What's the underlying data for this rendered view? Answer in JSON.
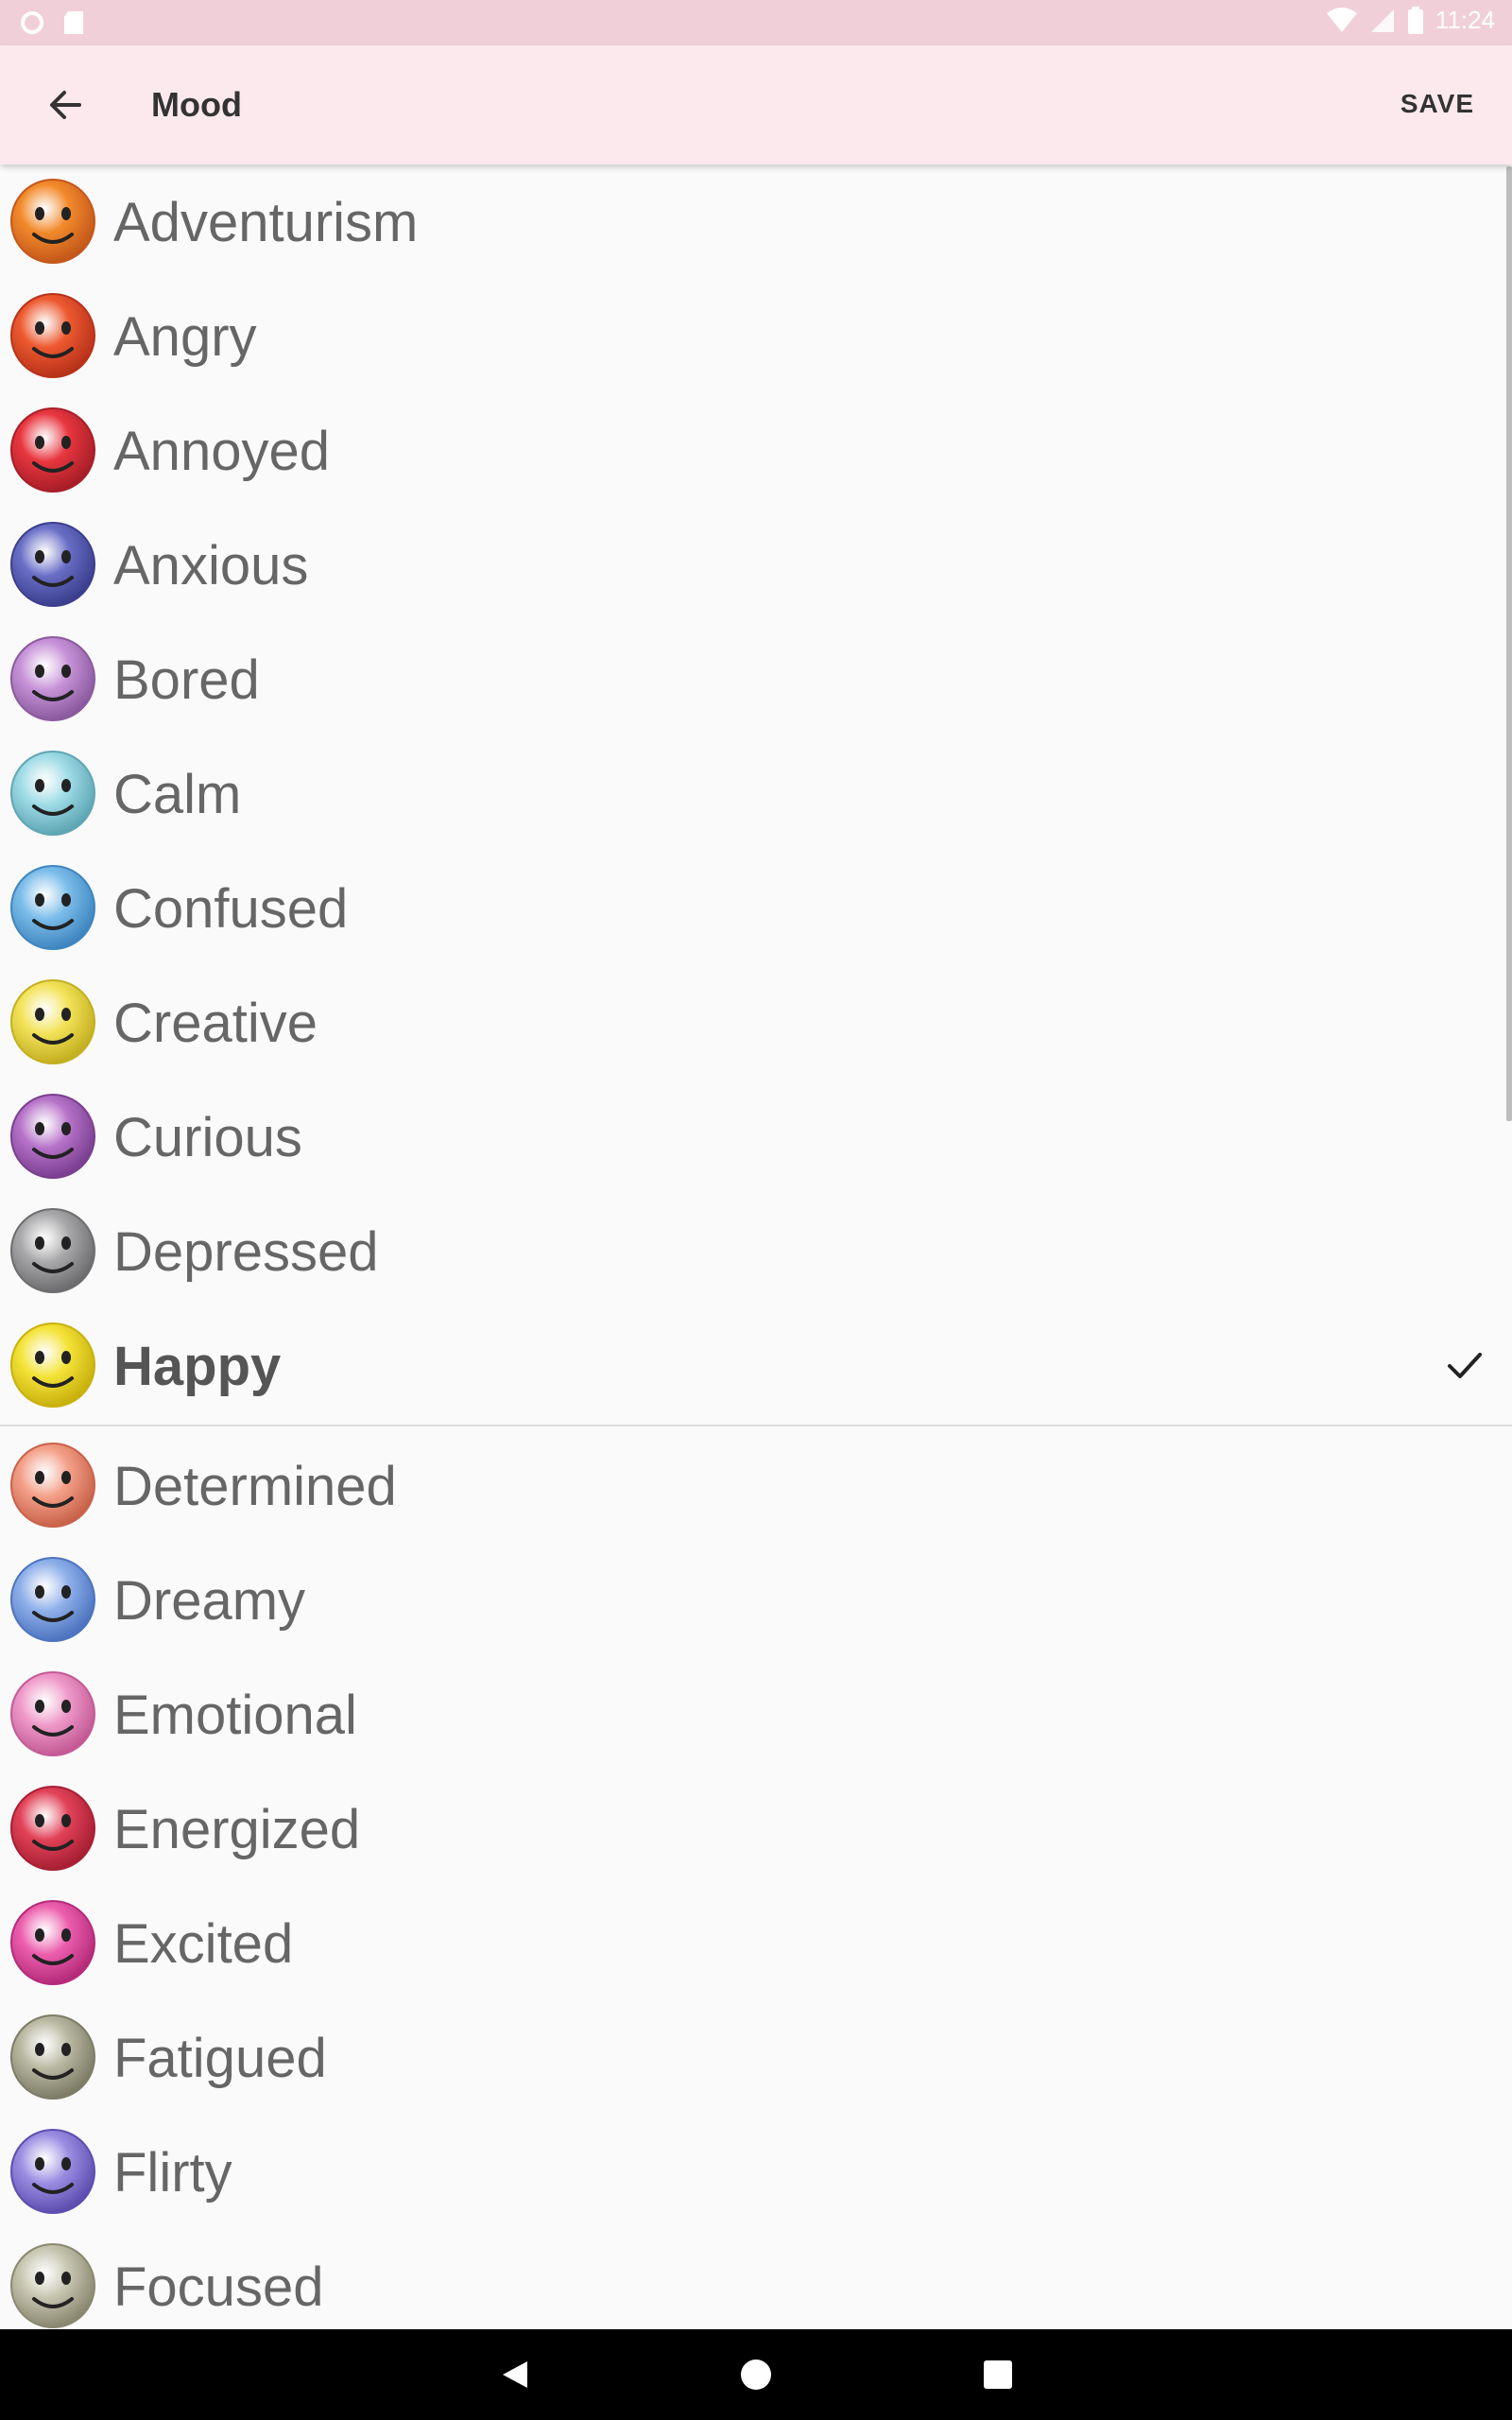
{
  "status_bar": {
    "time": "11:24"
  },
  "app_bar": {
    "title": "Mood",
    "save_label": "SAVE"
  },
  "moods": [
    {
      "label": "Adventurism",
      "color": "#f28a2b",
      "dark": "#c4581a"
    },
    {
      "label": "Angry",
      "color": "#ee5a30",
      "dark": "#b8321a"
    },
    {
      "label": "Annoyed",
      "color": "#e8363f",
      "dark": "#a81e28"
    },
    {
      "label": "Anxious",
      "color": "#6a6fc6",
      "dark": "#3c3f8e"
    },
    {
      "label": "Bored",
      "color": "#c792d8",
      "dark": "#8b5a9f"
    },
    {
      "label": "Calm",
      "color": "#9fdce6",
      "dark": "#5fa6b5"
    },
    {
      "label": "Confused",
      "color": "#7bbdea",
      "dark": "#3f86c0"
    },
    {
      "label": "Creative",
      "color": "#f3e35a",
      "dark": "#c4b020"
    },
    {
      "label": "Curious",
      "color": "#b773c9",
      "dark": "#7a3f90"
    },
    {
      "label": "Depressed",
      "color": "#a9a9ab",
      "dark": "#6d6d70"
    }
  ],
  "selected": {
    "label": "Happy",
    "color": "#f4e338",
    "dark": "#c9b10e"
  },
  "moods_after": [
    {
      "label": "Determined",
      "color": "#f4a089",
      "dark": "#c9624a"
    },
    {
      "label": "Dreamy",
      "color": "#8fb0ea",
      "dark": "#4d74c0"
    },
    {
      "label": "Emotional",
      "color": "#ef9ac9",
      "dark": "#c45a95"
    },
    {
      "label": "Energized",
      "color": "#e24258",
      "dark": "#a81f33"
    },
    {
      "label": "Excited",
      "color": "#ec5fae",
      "dark": "#b52b7a"
    },
    {
      "label": "Fatigued",
      "color": "#b9b8a1",
      "dark": "#7d7c66"
    },
    {
      "label": "Flirty",
      "color": "#9c8ee2",
      "dark": "#5d4eb0"
    },
    {
      "label": "Focused",
      "color": "#c7c6b1",
      "dark": "#8a8870"
    }
  ]
}
